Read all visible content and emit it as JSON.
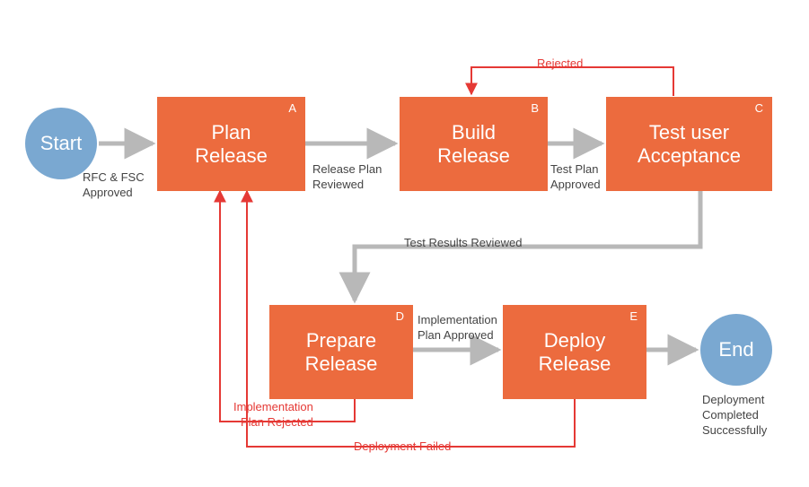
{
  "nodes": {
    "start": {
      "label": "Start"
    },
    "end": {
      "label": "End"
    },
    "a": {
      "letter": "A",
      "line1": "Plan",
      "line2": "Release"
    },
    "b": {
      "letter": "B",
      "line1": "Build",
      "line2": "Release"
    },
    "c": {
      "letter": "C",
      "line1": "Test user",
      "line2": "Acceptance"
    },
    "d": {
      "letter": "D",
      "line1": "Prepare",
      "line2": "Release"
    },
    "e": {
      "letter": "E",
      "line1": "Deploy",
      "line2": "Release"
    }
  },
  "edges": {
    "start_a": "RFC & FSC\nApproved",
    "a_b": "Release Plan\nReviewed",
    "b_c": "Test Plan\nApproved",
    "c_b": "Rejected",
    "c_d": "Test Results Reviewed",
    "d_e": "Implementation\nPlan Approved",
    "e_end": "Deployment\nCompleted\nSuccessfully",
    "d_a": "Implementation\nPlan Rejected",
    "e_a": "Deployment Failed"
  }
}
